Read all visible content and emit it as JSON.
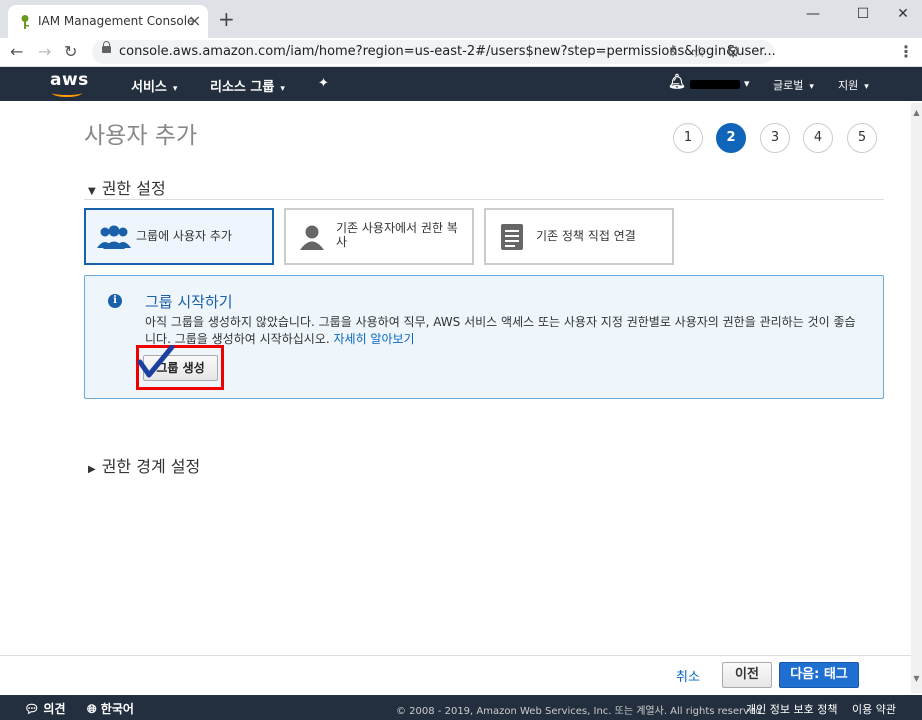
{
  "browser": {
    "tab_title": "IAM Management Console",
    "url": "console.aws.amazon.com/iam/home?region=us-east-2#/users$new?step=permissions&login&user..."
  },
  "aws_nav": {
    "logo": "aws",
    "services": "서비스",
    "resource_groups": "리소스 그룹",
    "global": "글로벌",
    "support": "지원"
  },
  "page": {
    "title": "사용자 추가",
    "steps": [
      "1",
      "2",
      "3",
      "4",
      "5"
    ],
    "active_step": 2
  },
  "permissions": {
    "section_title": "권한 설정",
    "options": [
      {
        "label": "그룹에 사용자 추가",
        "icon": "users-group-icon",
        "selected": true
      },
      {
        "label": "기존 사용자에서 권한 복사",
        "icon": "user-icon",
        "selected": false
      },
      {
        "label": "기존 정책 직접 연결",
        "icon": "document-icon",
        "selected": false
      }
    ]
  },
  "info": {
    "title": "그룹 시작하기",
    "text": "아직 그룹을 생성하지 않았습니다. 그룹을 사용하여 직무, AWS 서비스 액세스 또는 사용자 지정 권한별로 사용자의 권한을 관리하는 것이 좋습니다. 그룹을 생성하여 시작하십시오. ",
    "link": "자세히 알아보기",
    "create_button": "그룹 생성"
  },
  "boundary": {
    "section_title": "권한 경계 설정"
  },
  "actions": {
    "cancel": "취소",
    "previous": "이전",
    "next": "다음: 태그"
  },
  "footer": {
    "feedback": "의견",
    "language": "한국어",
    "copyright": "© 2008 - 2019, Amazon Web Services, Inc. 또는 계열사. All rights reserved.",
    "privacy": "개인 정보 보호 정책",
    "terms": "이용 약관"
  },
  "colors": {
    "aws_nav_bg": "#232f3e",
    "aws_orange": "#ff9900",
    "primary_blue": "#1f6fd1",
    "highlight_red": "#e00000"
  }
}
